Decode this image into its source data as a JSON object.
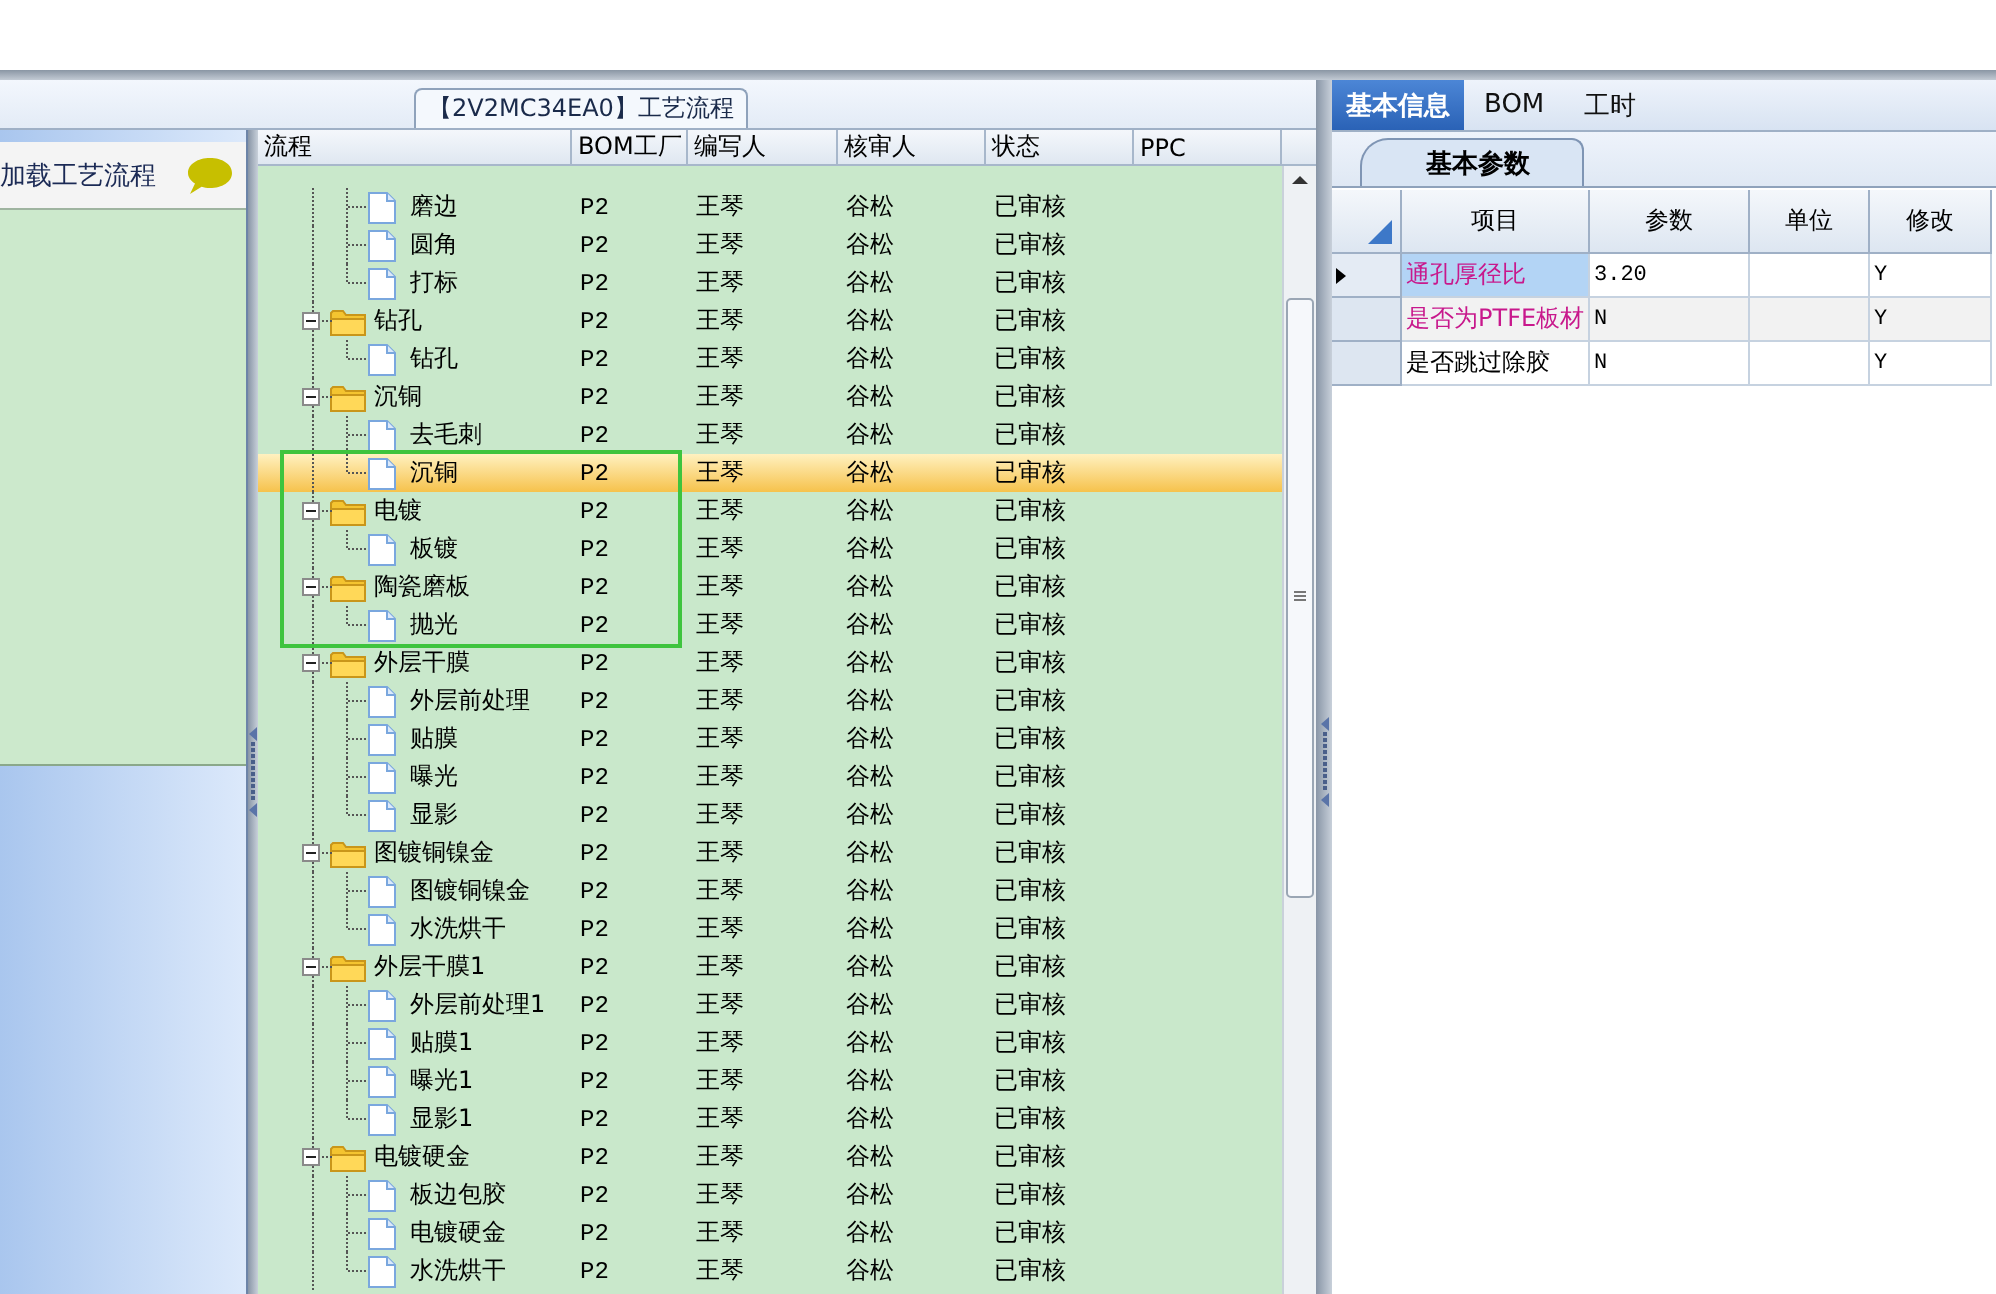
{
  "process_panel": {
    "title": "【2V2MC34EA0】工艺流程"
  },
  "left_panel": {
    "load_label": "加载工艺流程"
  },
  "grid": {
    "columns": [
      "流程",
      "BOM工厂",
      "编写人",
      "核审人",
      "状态",
      "PPC"
    ],
    "tree": [
      {
        "kind": "continued",
        "children": [
          {
            "name": "磨边",
            "bom": "P2",
            "writer": "王琴",
            "reviewer": "谷松",
            "status": "已审核",
            "selected": false
          },
          {
            "name": "圆角",
            "bom": "P2",
            "writer": "王琴",
            "reviewer": "谷松",
            "status": "已审核",
            "selected": false
          },
          {
            "name": "打标",
            "bom": "P2",
            "writer": "王琴",
            "reviewer": "谷松",
            "status": "已审核",
            "selected": false
          }
        ]
      },
      {
        "kind": "folder",
        "name": "钻孔",
        "bom": "P2",
        "writer": "王琴",
        "reviewer": "谷松",
        "status": "已审核",
        "selected": false,
        "expanded": true,
        "children": [
          {
            "name": "钻孔",
            "bom": "P2",
            "writer": "王琴",
            "reviewer": "谷松",
            "status": "已审核",
            "selected": false
          }
        ]
      },
      {
        "kind": "folder",
        "name": "沉铜",
        "bom": "P2",
        "writer": "王琴",
        "reviewer": "谷松",
        "status": "已审核",
        "selected": false,
        "expanded": true,
        "children": [
          {
            "name": "去毛刺",
            "bom": "P2",
            "writer": "王琴",
            "reviewer": "谷松",
            "status": "已审核",
            "selected": false
          },
          {
            "name": "沉铜",
            "bom": "P2",
            "writer": "王琴",
            "reviewer": "谷松",
            "status": "已审核",
            "selected": true
          }
        ]
      },
      {
        "kind": "folder",
        "name": "电镀",
        "bom": "P2",
        "writer": "王琴",
        "reviewer": "谷松",
        "status": "已审核",
        "selected": false,
        "expanded": true,
        "children": [
          {
            "name": "板镀",
            "bom": "P2",
            "writer": "王琴",
            "reviewer": "谷松",
            "status": "已审核",
            "selected": false
          }
        ]
      },
      {
        "kind": "folder",
        "name": "陶瓷磨板",
        "bom": "P2",
        "writer": "王琴",
        "reviewer": "谷松",
        "status": "已审核",
        "selected": false,
        "expanded": true,
        "children": [
          {
            "name": "抛光",
            "bom": "P2",
            "writer": "王琴",
            "reviewer": "谷松",
            "status": "已审核",
            "selected": false
          }
        ]
      },
      {
        "kind": "folder",
        "name": "外层干膜",
        "bom": "P2",
        "writer": "王琴",
        "reviewer": "谷松",
        "status": "已审核",
        "selected": false,
        "expanded": true,
        "children": [
          {
            "name": "外层前处理",
            "bom": "P2",
            "writer": "王琴",
            "reviewer": "谷松",
            "status": "已审核",
            "selected": false
          },
          {
            "name": "贴膜",
            "bom": "P2",
            "writer": "王琴",
            "reviewer": "谷松",
            "status": "已审核",
            "selected": false
          },
          {
            "name": "曝光",
            "bom": "P2",
            "writer": "王琴",
            "reviewer": "谷松",
            "status": "已审核",
            "selected": false
          },
          {
            "name": "显影",
            "bom": "P2",
            "writer": "王琴",
            "reviewer": "谷松",
            "status": "已审核",
            "selected": false
          }
        ]
      },
      {
        "kind": "folder",
        "name": "图镀铜镍金",
        "bom": "P2",
        "writer": "王琴",
        "reviewer": "谷松",
        "status": "已审核",
        "selected": false,
        "expanded": true,
        "children": [
          {
            "name": "图镀铜镍金",
            "bom": "P2",
            "writer": "王琴",
            "reviewer": "谷松",
            "status": "已审核",
            "selected": false
          },
          {
            "name": "水洗烘干",
            "bom": "P2",
            "writer": "王琴",
            "reviewer": "谷松",
            "status": "已审核",
            "selected": false
          }
        ]
      },
      {
        "kind": "folder",
        "name": "外层干膜1",
        "bom": "P2",
        "writer": "王琴",
        "reviewer": "谷松",
        "status": "已审核",
        "selected": false,
        "expanded": true,
        "children": [
          {
            "name": "外层前处理1",
            "bom": "P2",
            "writer": "王琴",
            "reviewer": "谷松",
            "status": "已审核",
            "selected": false
          },
          {
            "name": "贴膜1",
            "bom": "P2",
            "writer": "王琴",
            "reviewer": "谷松",
            "status": "已审核",
            "selected": false
          },
          {
            "name": "曝光1",
            "bom": "P2",
            "writer": "王琴",
            "reviewer": "谷松",
            "status": "已审核",
            "selected": false
          },
          {
            "name": "显影1",
            "bom": "P2",
            "writer": "王琴",
            "reviewer": "谷松",
            "status": "已审核",
            "selected": false
          }
        ]
      },
      {
        "kind": "folder",
        "name": "电镀硬金",
        "bom": "P2",
        "writer": "王琴",
        "reviewer": "谷松",
        "status": "已审核",
        "selected": false,
        "expanded": true,
        "children": [
          {
            "name": "板边包胶",
            "bom": "P2",
            "writer": "王琴",
            "reviewer": "谷松",
            "status": "已审核",
            "selected": false
          },
          {
            "name": "电镀硬金",
            "bom": "P2",
            "writer": "王琴",
            "reviewer": "谷松",
            "status": "已审核",
            "selected": false
          },
          {
            "name": "水洗烘干",
            "bom": "P2",
            "writer": "王琴",
            "reviewer": "谷松",
            "status": "已审核",
            "selected": false
          }
        ]
      }
    ]
  },
  "info_panel": {
    "tabs": [
      {
        "label": "基本信息",
        "selected": true
      },
      {
        "label": "BOM",
        "selected": false
      },
      {
        "label": "工时",
        "selected": false
      }
    ],
    "subtabs": [
      {
        "label": "基本参数",
        "selected": true
      }
    ],
    "columns": [
      "项目",
      "参数",
      "单位",
      "修改"
    ],
    "rows": [
      {
        "item": "通孔厚径比",
        "value": "3.20",
        "modify": "Y",
        "color": "#c8188c",
        "selected": true
      },
      {
        "item": "是否为PTFE板材",
        "value": "N",
        "modify": "Y",
        "color": "#c8188c",
        "selected": false
      },
      {
        "item": "是否跳过除胶",
        "value": "N",
        "modify": "Y",
        "color": "#000000",
        "selected": false
      }
    ]
  }
}
